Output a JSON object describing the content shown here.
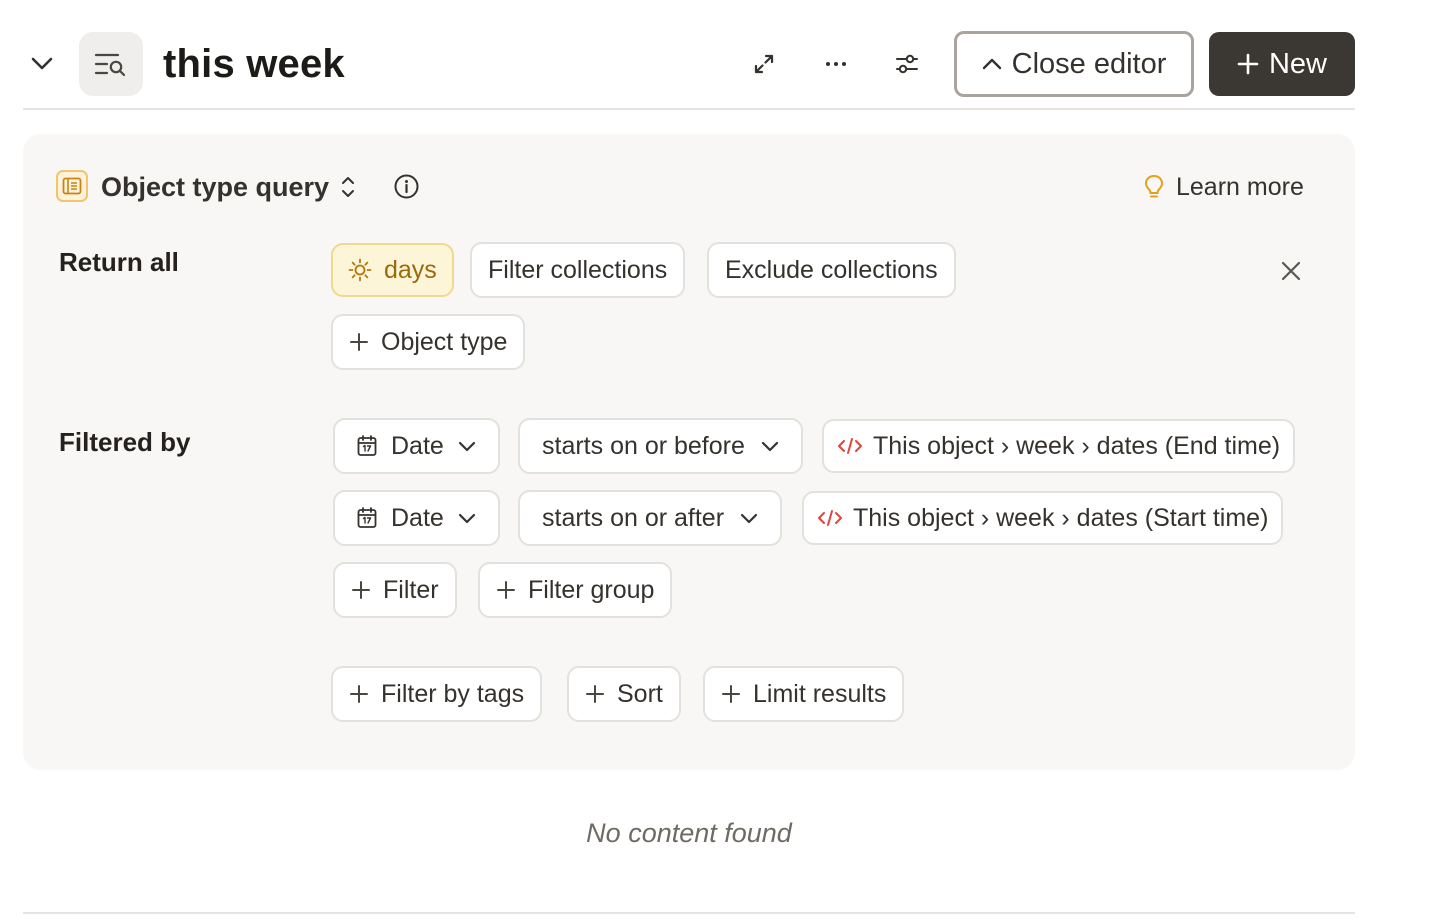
{
  "header": {
    "title": "this week",
    "close_editor_label": "Close editor",
    "new_label": "New",
    "icons": [
      "chevron-down-icon",
      "view-search-icon",
      "expand-icon",
      "more-icon",
      "settings-sliders-icon"
    ]
  },
  "editor": {
    "query_type": "Object type query",
    "learn_more": "Learn more",
    "return_all": {
      "label": "Return all",
      "type_chip": "days",
      "filter_collections": "Filter collections",
      "exclude_collections": "Exclude collections",
      "add_object_type": "Object type"
    },
    "filtered_by": {
      "label": "Filtered by",
      "filters": [
        {
          "property": "Date",
          "operator": "starts on or before",
          "value": "This object › week › dates (End time)"
        },
        {
          "property": "Date",
          "operator": "starts on or after",
          "value": "This object › week › dates (Start time)"
        }
      ],
      "add_filter": "Filter",
      "add_filter_group": "Filter group"
    },
    "extras": {
      "filter_by_tags": "Filter by tags",
      "sort": "Sort",
      "limit_results": "Limit results"
    }
  },
  "results": {
    "empty_message": "No content found"
  },
  "colors": {
    "primary_button": "#3b3833",
    "days_chip_bg": "#fdf5d7",
    "days_chip_text": "#9a6a0b",
    "code_icon": "#e0453a",
    "panel_bg": "#f8f7f5"
  }
}
